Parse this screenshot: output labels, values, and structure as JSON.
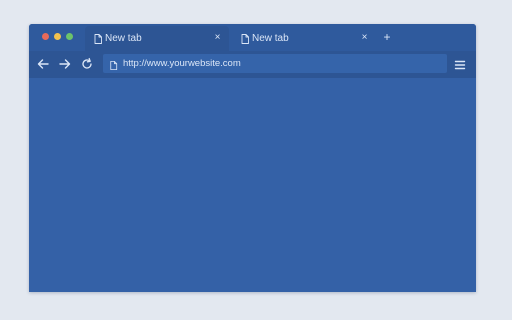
{
  "window": {
    "controls": [
      {
        "name": "close",
        "color": "#e86a5a"
      },
      {
        "name": "minimize",
        "color": "#f2c14e"
      },
      {
        "name": "maximize",
        "color": "#6cc36a"
      }
    ]
  },
  "tabs": [
    {
      "title": "New tab",
      "active": true,
      "icon": "page-icon",
      "close": "×"
    },
    {
      "title": "New tab",
      "active": false,
      "icon": "page-icon",
      "close": "×"
    }
  ],
  "new_tab_label": "+",
  "toolbar": {
    "back_icon": "back-arrow-icon",
    "forward_icon": "forward-arrow-icon",
    "reload_icon": "reload-icon",
    "menu_icon": "hamburger-menu-icon"
  },
  "address_bar": {
    "url": "http://www.yourwebsite.com",
    "icon": "page-icon"
  },
  "colors": {
    "page_background": "#e3e8f0",
    "window": "#3461a7",
    "tab_bar": "#2f5a9d",
    "active_tab": "#2d5594",
    "toolbar": "#2d5594",
    "text": "#dbe6f7"
  }
}
